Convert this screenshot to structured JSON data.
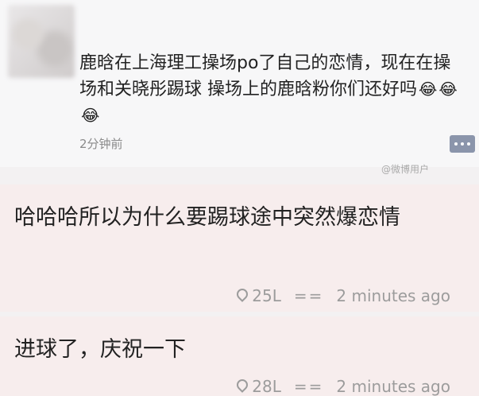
{
  "post": {
    "text": "鹿晗在上海理工操场po了自己的恋情，现在在操场和关晓彤踢球 操场上的鹿晗粉你们还好吗",
    "emojis": [
      "😂",
      "😂",
      "😂"
    ],
    "time": "2分钟前",
    "watermark": "@微博用户"
  },
  "replies": [
    {
      "text": "哈哈哈所以为什么要踢球途中突然爆恋情",
      "floor": "25L",
      "sep": "==",
      "time": "2 minutes ago"
    },
    {
      "text": "进球了，庆祝一下",
      "floor": "28L",
      "sep": "==",
      "time": "2 minutes ago"
    }
  ]
}
